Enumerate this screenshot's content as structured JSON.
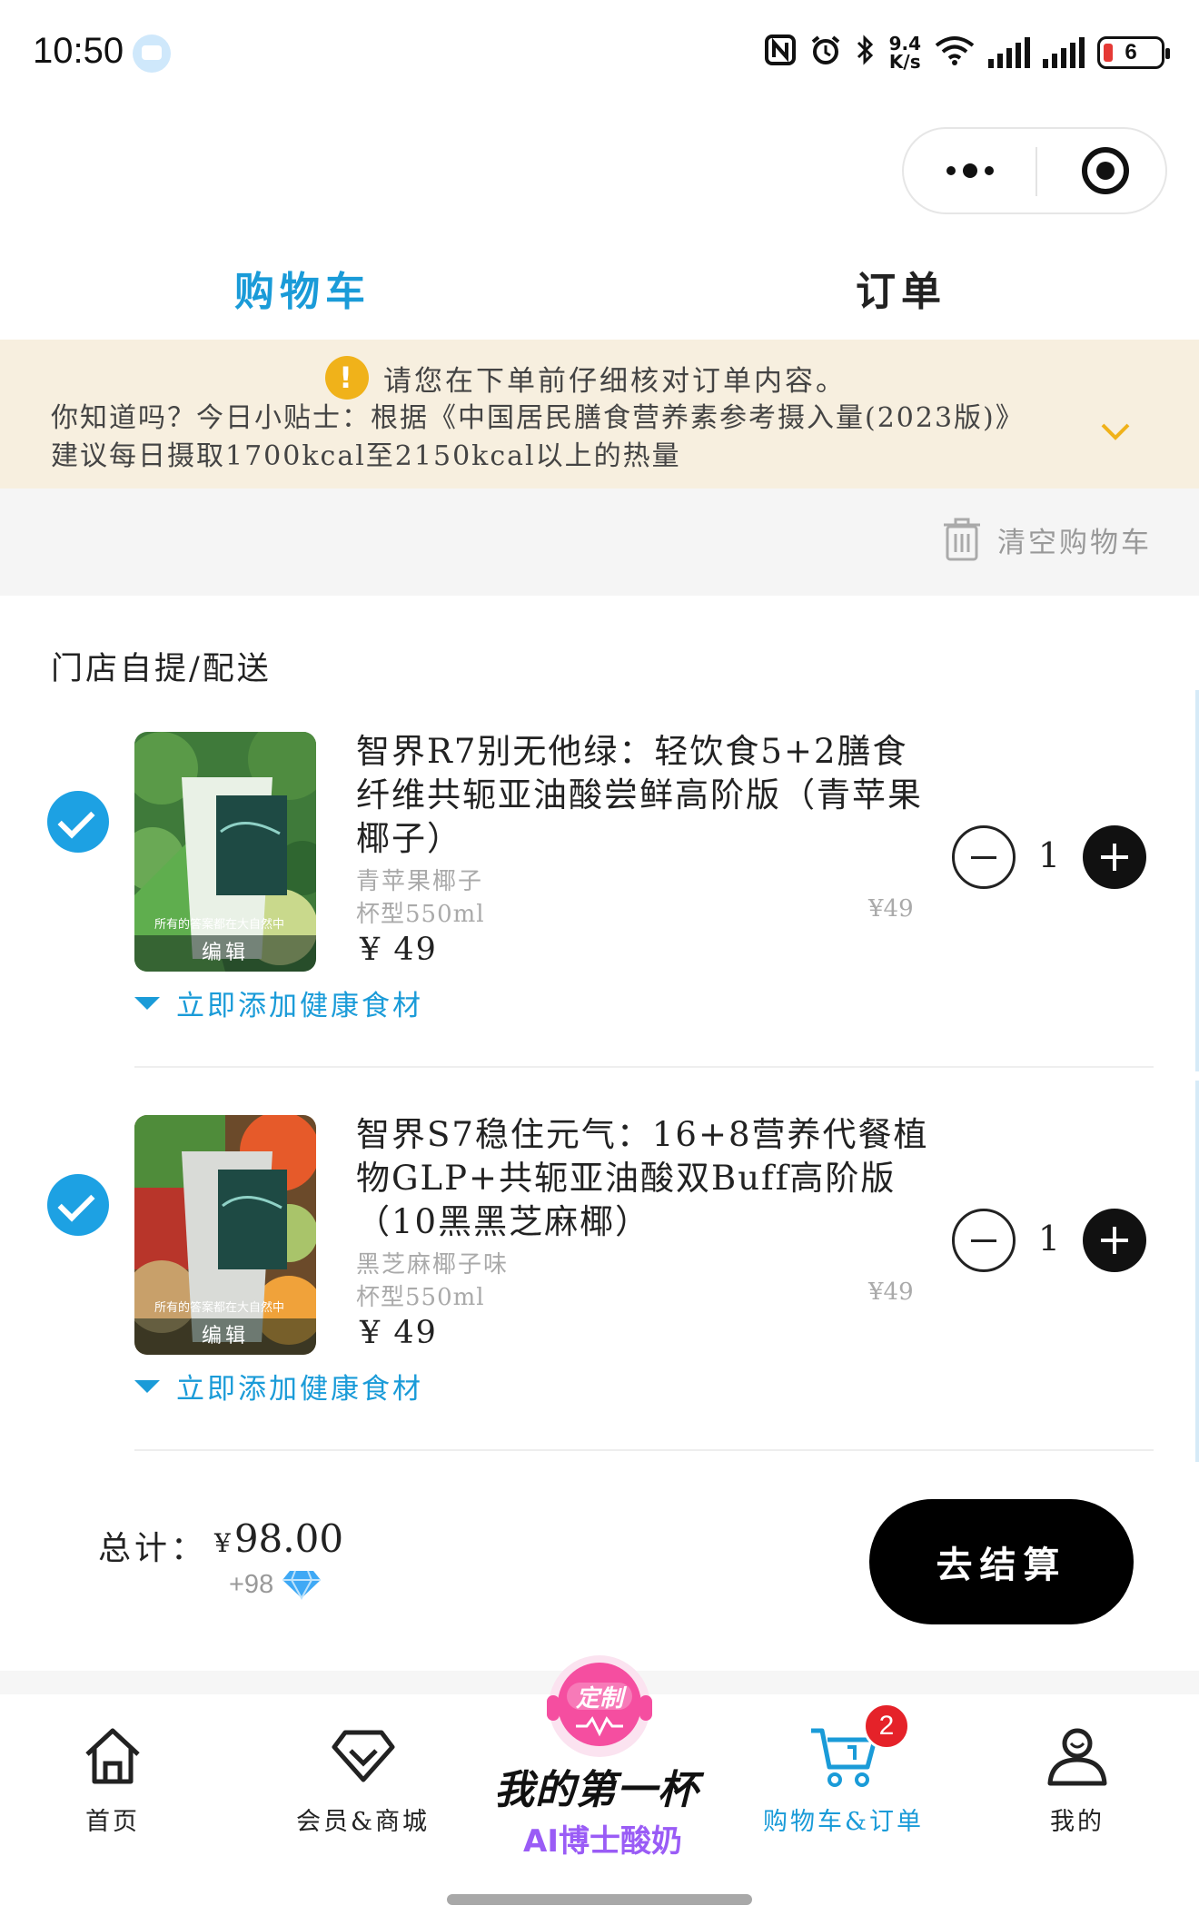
{
  "status_bar": {
    "time": "10:50",
    "net_speed_top": "9.4",
    "net_speed_bottom": "K/s",
    "battery": "6"
  },
  "tabs": [
    {
      "label": "购物车",
      "active": true
    },
    {
      "label": "订单",
      "active": false
    }
  ],
  "notice": {
    "warning": "请您在下单前仔细核对订单内容。",
    "tip": "你知道吗？今日小贴士：根据《中国居民膳食营养素参考摄入量(2023版)》建议每日摄取1700kcal至2150kcal以上的热量"
  },
  "clear_cart_label": "清空购物车",
  "section_title": "门店自提/配送",
  "items": [
    {
      "title": "智界R7别无他绿：轻饮食5+2膳食纤维共轭亚油酸尝鲜高阶版（青苹果椰子）",
      "variant": "青苹果椰子",
      "cup": "杯型550ml",
      "unit_price": "¥49",
      "price": "¥ 49",
      "quantity": "1",
      "edit_label": "编辑",
      "caption": "所有的答案都在大自然中",
      "add_ingredient_label": "立即添加健康食材",
      "checked": true
    },
    {
      "title": "智界S7稳住元气：16+8营养代餐植物GLP+共轭亚油酸双Buff高阶版（10黑黑芝麻椰）",
      "variant": "黑芝麻椰子味",
      "cup": "杯型550ml",
      "unit_price": "¥49",
      "price": "¥ 49",
      "quantity": "1",
      "edit_label": "编辑",
      "caption": "所有的答案都在大自然中",
      "add_ingredient_label": "立即添加健康食材",
      "checked": true
    }
  ],
  "total": {
    "label": "总计：",
    "currency": "¥",
    "amount": "98.00",
    "points": "+98"
  },
  "checkout_label": "去结算",
  "nav": {
    "items": [
      {
        "label": "首页",
        "icon": "home-icon"
      },
      {
        "label": "会员&商城",
        "icon": "diamond-icon"
      },
      {
        "label": "购物车&订单",
        "icon": "cart-icon",
        "active": true
      },
      {
        "label": "我的",
        "icon": "user-icon"
      }
    ],
    "cart_badge": "2",
    "center": {
      "badge_text": "定制",
      "title": "我的第一杯",
      "subtitle": "AI博士酸奶"
    }
  },
  "colors": {
    "accent": "#1a9bd8",
    "notice_bg": "#f7efdf",
    "checkout_bg": "#000000",
    "badge_red": "#e52229",
    "center_pink": "#f54ea0"
  }
}
